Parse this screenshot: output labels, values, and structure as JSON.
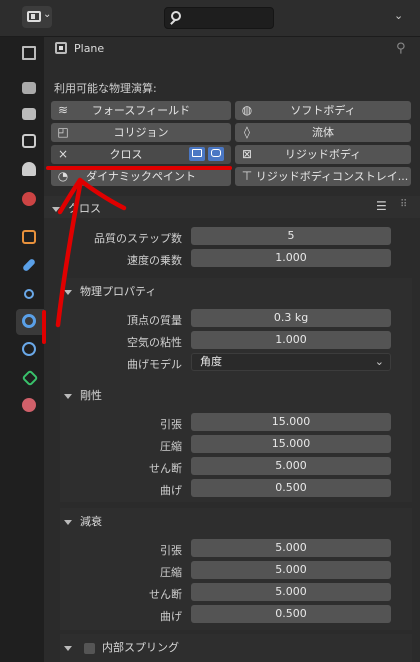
{
  "header": {
    "editor_type_dropdown": "⌄",
    "search_placeholder": "",
    "right_dropdown": "⌄"
  },
  "object": {
    "name": "Plane"
  },
  "physics": {
    "available_label": "利用可能な物理演算:",
    "buttons": [
      {
        "label": "フォースフィールド",
        "icon": "forcefield-icon"
      },
      {
        "label": "ソフトボディ",
        "icon": "softbody-icon"
      },
      {
        "label": "コリジョン",
        "icon": "collision-icon"
      },
      {
        "label": "流体",
        "icon": "fluid-icon"
      },
      {
        "label": "クロス",
        "icon": "close-icon"
      },
      {
        "label": "リジッドボディ",
        "icon": "rigidbody-icon"
      },
      {
        "label": "ダイナミックペイント",
        "icon": "dynamicpaint-icon"
      },
      {
        "label": "リジッドボディコンストレイ...",
        "icon": "rigidbody-constraint-icon"
      }
    ]
  },
  "cloth": {
    "title": "クロス",
    "quality_label": "品質のステップ数",
    "quality_value": "5",
    "speed_label": "速度の乗数",
    "speed_value": "1.000",
    "props_title": "物理プロパティ",
    "mass_label": "頂点の質量",
    "mass_value": "0.3 kg",
    "air_label": "空気の粘性",
    "air_value": "1.000",
    "bend_model_label": "曲げモデル",
    "bend_model_value": "角度"
  },
  "stiffness": {
    "title": "剛性",
    "tension_label": "引張",
    "tension_value": "15.000",
    "compression_label": "圧縮",
    "compression_value": "15.000",
    "shear_label": "せん断",
    "shear_value": "5.000",
    "bending_label": "曲げ",
    "bending_value": "0.500"
  },
  "damping": {
    "title": "減衰",
    "tension_label": "引張",
    "tension_value": "5.000",
    "compression_label": "圧縮",
    "compression_value": "5.000",
    "shear_label": "せん断",
    "shear_value": "5.000",
    "bending_label": "曲げ",
    "bending_value": "0.500"
  },
  "internal_springs": {
    "title": "内部スプリング"
  }
}
